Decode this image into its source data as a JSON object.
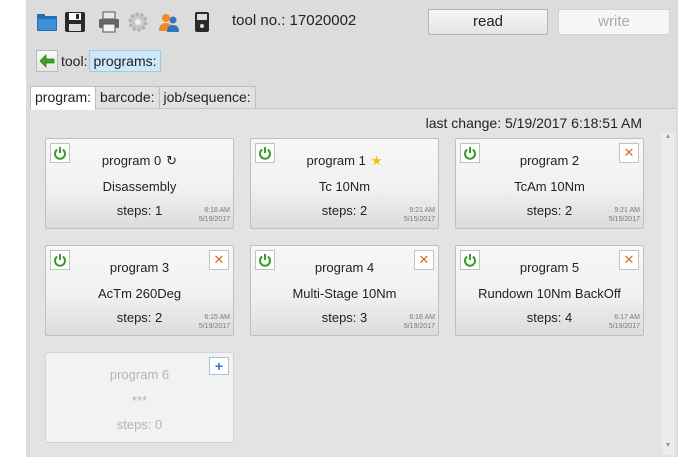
{
  "toolbar": {
    "icons": [
      "folder-open-icon",
      "save-icon",
      "print-icon",
      "gear-icon",
      "users-icon",
      "device-icon"
    ],
    "tool_no_label": "tool no.: 17020002",
    "read_label": "read",
    "write_label": "write"
  },
  "breadcrumb": {
    "tool": "tool:",
    "programs": "programs:"
  },
  "tabs": [
    "program:",
    "barcode:",
    "job/sequence:"
  ],
  "last_change": "last change:  5/19/2017  6:18:51 AM",
  "colors": {
    "power_green": "#3a9a2a",
    "delete_orange": "#e06a1e",
    "star_yellow": "#f2c200",
    "add_blue": "#2e78c7",
    "selected_crumb_bg": "#cfe8f8"
  },
  "programs": [
    {
      "title": "program 0",
      "mark": "↻",
      "mark_icon": "restore-icon",
      "name": "Disassembly",
      "steps": "steps: 1",
      "time": "6:18 AM",
      "date": "5/19/2017"
    },
    {
      "title": "program 1",
      "mark": "★",
      "mark_icon": "star-icon",
      "name": "Tc 10Nm",
      "steps": "steps: 2",
      "time": "9:21 AM",
      "date": "5/15/2017"
    },
    {
      "title": "program 2",
      "name": "TcAm 10Nm",
      "steps": "steps: 2",
      "time": "9:21 AM",
      "date": "5/15/2017"
    },
    {
      "title": "program 3",
      "name": "AcTm 260Deg",
      "steps": "steps: 2",
      "time": "6:15 AM",
      "date": "5/19/2017"
    },
    {
      "title": "program 4",
      "name": "Multi-Stage 10Nm",
      "steps": "steps: 3",
      "time": "6:16 AM",
      "date": "5/19/2017"
    },
    {
      "title": "program 5",
      "name": "Rundown 10Nm BackOff",
      "steps": "steps: 4",
      "time": "6:17 AM",
      "date": "5/19/2017"
    },
    {
      "title": "program 6",
      "name": "***",
      "steps": "steps: 0"
    }
  ]
}
